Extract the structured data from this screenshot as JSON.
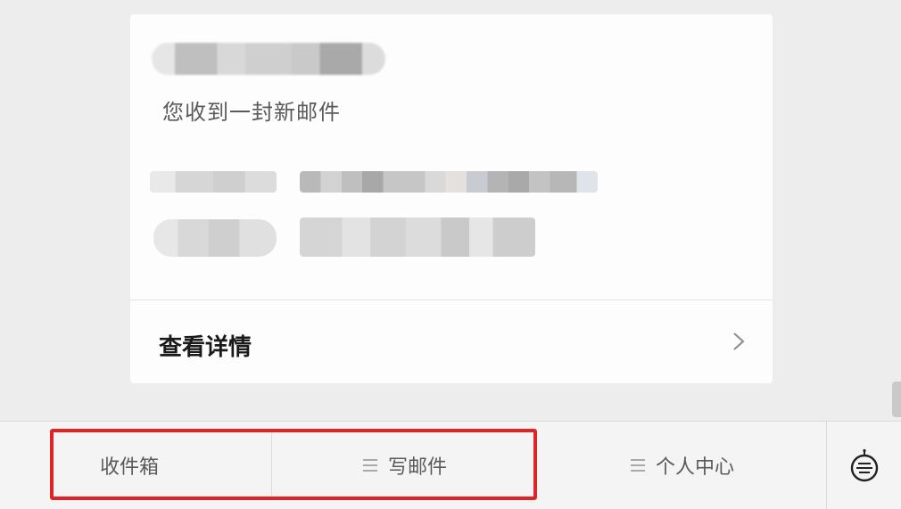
{
  "message": {
    "notice": "您收到一封新邮件",
    "details_label": "查看详情"
  },
  "bottom_nav": {
    "inbox": "收件箱",
    "compose": "写邮件",
    "profile": "个人中心"
  },
  "icons": {
    "menu": "menu-lines-icon",
    "chevron": "chevron-right-icon",
    "bot": "robot-assistant-icon"
  },
  "colors": {
    "highlight": "#e02424",
    "background": "#ededed",
    "card": "#fdfdfd"
  }
}
